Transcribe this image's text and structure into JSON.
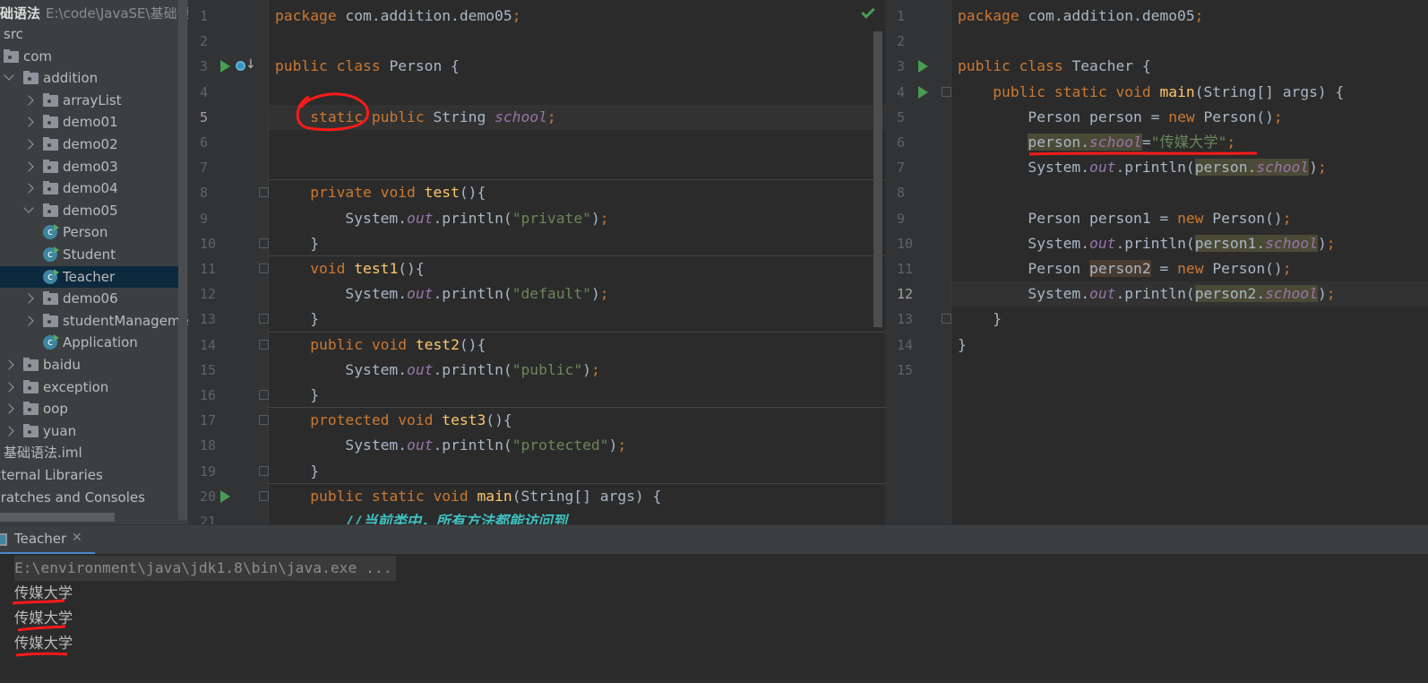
{
  "project": {
    "name": "础语法",
    "path": "E:\\code\\JavaSE\\基础语法"
  },
  "tree": [
    {
      "label": "src",
      "indent": 0,
      "icon": "none",
      "arrow": "none"
    },
    {
      "label": "com",
      "indent": 0,
      "icon": "package",
      "arrow": "none"
    },
    {
      "label": "addition",
      "indent": 0,
      "icon": "package",
      "arrow": "open"
    },
    {
      "label": "arrayList",
      "indent": 1,
      "icon": "package",
      "arrow": "closed"
    },
    {
      "label": "demo01",
      "indent": 1,
      "icon": "package",
      "arrow": "closed"
    },
    {
      "label": "demo02",
      "indent": 1,
      "icon": "package",
      "arrow": "closed"
    },
    {
      "label": "demo03",
      "indent": 1,
      "icon": "package",
      "arrow": "closed"
    },
    {
      "label": "demo04",
      "indent": 1,
      "icon": "package",
      "arrow": "closed"
    },
    {
      "label": "demo05",
      "indent": 1,
      "icon": "package",
      "arrow": "open"
    },
    {
      "label": "Person",
      "indent": 2,
      "icon": "class",
      "arrow": "none"
    },
    {
      "label": "Student",
      "indent": 2,
      "icon": "class",
      "arrow": "none"
    },
    {
      "label": "Teacher",
      "indent": 2,
      "icon": "class",
      "arrow": "none",
      "selected": true
    },
    {
      "label": "demo06",
      "indent": 1,
      "icon": "package",
      "arrow": "closed"
    },
    {
      "label": "studentManagement",
      "indent": 1,
      "icon": "package",
      "arrow": "closed"
    },
    {
      "label": "Application",
      "indent": 1,
      "icon": "class",
      "arrow": "none",
      "noArrowSpace": true
    },
    {
      "label": "baidu",
      "indent": 0,
      "icon": "package",
      "arrow": "closed"
    },
    {
      "label": "exception",
      "indent": 0,
      "icon": "package",
      "arrow": "closed"
    },
    {
      "label": "oop",
      "indent": 0,
      "icon": "package",
      "arrow": "closed"
    },
    {
      "label": "yuan",
      "indent": 0,
      "icon": "package",
      "arrow": "closed"
    },
    {
      "label": "基础语法.iml",
      "indent": 0,
      "icon": "none",
      "arrow": "none"
    },
    {
      "label": "External Libraries",
      "indent": -1,
      "icon": "none",
      "arrow": "none"
    },
    {
      "label": "Scratches and Consoles",
      "indent": -1,
      "icon": "none",
      "arrow": "none"
    }
  ],
  "left_editor": {
    "file": "Person",
    "current_line": 5,
    "status_icon": "check-icon",
    "lines": [
      [
        [
          "kw",
          "package "
        ],
        [
          "id",
          "com.addition.demo05"
        ],
        [
          "kw",
          ";"
        ]
      ],
      [],
      [
        [
          "kw",
          "public class "
        ],
        [
          "id",
          "Person {"
        ]
      ],
      [],
      [
        [
          "id",
          "    "
        ],
        [
          "kw",
          "static public "
        ],
        [
          "id",
          "String "
        ],
        [
          "field",
          "school"
        ],
        [
          "kw",
          ";"
        ]
      ],
      [],
      [],
      [
        [
          "id",
          "    "
        ],
        [
          "kw",
          "private void "
        ],
        [
          "fn",
          "test"
        ],
        [
          "id",
          "(){"
        ]
      ],
      [
        [
          "id",
          "        System."
        ],
        [
          "field",
          "out"
        ],
        [
          "id",
          ".println("
        ],
        [
          "str",
          "\"private\""
        ],
        [
          "id",
          ")"
        ],
        [
          "kw",
          ";"
        ]
      ],
      [
        [
          "id",
          "    }"
        ]
      ],
      [
        [
          "id",
          "    "
        ],
        [
          "kw",
          "void "
        ],
        [
          "fn",
          "test1"
        ],
        [
          "id",
          "(){"
        ]
      ],
      [
        [
          "id",
          "        System."
        ],
        [
          "field",
          "out"
        ],
        [
          "id",
          ".println("
        ],
        [
          "str",
          "\"default\""
        ],
        [
          "id",
          ")"
        ],
        [
          "kw",
          ";"
        ]
      ],
      [
        [
          "id",
          "    }"
        ]
      ],
      [
        [
          "id",
          "    "
        ],
        [
          "kw",
          "public void "
        ],
        [
          "fn",
          "test2"
        ],
        [
          "id",
          "(){"
        ]
      ],
      [
        [
          "id",
          "        System."
        ],
        [
          "field",
          "out"
        ],
        [
          "id",
          ".println("
        ],
        [
          "str",
          "\"public\""
        ],
        [
          "id",
          ")"
        ],
        [
          "kw",
          ";"
        ]
      ],
      [
        [
          "id",
          "    }"
        ]
      ],
      [
        [
          "id",
          "    "
        ],
        [
          "kw",
          "protected void "
        ],
        [
          "fn",
          "test3"
        ],
        [
          "id",
          "(){"
        ]
      ],
      [
        [
          "id",
          "        System."
        ],
        [
          "field",
          "out"
        ],
        [
          "id",
          ".println("
        ],
        [
          "str",
          "\"protected\""
        ],
        [
          "id",
          ")"
        ],
        [
          "kw",
          ";"
        ]
      ],
      [
        [
          "id",
          "    }"
        ]
      ],
      [
        [
          "id",
          "    "
        ],
        [
          "kw",
          "public static void "
        ],
        [
          "fn",
          "main"
        ],
        [
          "id",
          "(String[] args) {"
        ]
      ],
      [
        [
          "id",
          "        "
        ],
        [
          "cm",
          "//当前类中，所有方法都能访问到"
        ]
      ]
    ]
  },
  "right_editor": {
    "file": "Teacher",
    "current_line": 12,
    "lines": [
      [
        [
          "kw",
          "package "
        ],
        [
          "id",
          "com.addition.demo05"
        ],
        [
          "kw",
          ";"
        ]
      ],
      [],
      [
        [
          "kw",
          "public class "
        ],
        [
          "id",
          "Teacher {"
        ]
      ],
      [
        [
          "id",
          "    "
        ],
        [
          "kw",
          "public static void "
        ],
        [
          "fn",
          "main"
        ],
        [
          "id",
          "(String[] args) {"
        ]
      ],
      [
        [
          "id",
          "        Person person = "
        ],
        [
          "kw",
          "new "
        ],
        [
          "id",
          "Person()"
        ],
        [
          "kw",
          ";"
        ]
      ],
      [
        [
          "id",
          "        "
        ],
        [
          "id",
          "person.",
          "hl"
        ],
        [
          "field",
          "school",
          "hl"
        ],
        [
          "id",
          "="
        ],
        [
          "str",
          "\"传媒大学\""
        ],
        [
          "kw",
          ";"
        ]
      ],
      [
        [
          "id",
          "        System."
        ],
        [
          "field",
          "out"
        ],
        [
          "id",
          ".println("
        ],
        [
          "id",
          "person.",
          "hl"
        ],
        [
          "field",
          "school",
          "hl"
        ],
        [
          "id",
          ")"
        ],
        [
          "kw",
          ";"
        ]
      ],
      [],
      [
        [
          "id",
          "        Person person1 = "
        ],
        [
          "kw",
          "new "
        ],
        [
          "id",
          "Person()"
        ],
        [
          "kw",
          ";"
        ]
      ],
      [
        [
          "id",
          "        System."
        ],
        [
          "field",
          "out"
        ],
        [
          "id",
          ".println("
        ],
        [
          "id",
          "person1.",
          "hl"
        ],
        [
          "field",
          "school",
          "hl"
        ],
        [
          "id",
          ")"
        ],
        [
          "kw",
          ";"
        ]
      ],
      [
        [
          "id",
          "        Person "
        ],
        [
          "id",
          "person2",
          "hl2"
        ],
        [
          "id",
          " = "
        ],
        [
          "kw",
          "new "
        ],
        [
          "id",
          "Person()"
        ],
        [
          "kw",
          ";"
        ]
      ],
      [
        [
          "id",
          "        System."
        ],
        [
          "field",
          "out"
        ],
        [
          "id",
          ".println("
        ],
        [
          "id",
          "person2.",
          "hl"
        ],
        [
          "field",
          "school",
          "hl"
        ],
        [
          "id",
          ")"
        ],
        [
          "kw",
          ";"
        ]
      ],
      [
        [
          "id",
          "    }"
        ]
      ],
      [
        [
          "id",
          "}"
        ]
      ],
      []
    ]
  },
  "console": {
    "tab_label": "Teacher",
    "command": "E:\\environment\\java\\jdk1.8\\bin\\java.exe ...",
    "output": [
      "传媒大学",
      "传媒大学",
      "传媒大学"
    ]
  },
  "colors": {
    "annotation": "#ff1a1a",
    "accent": "#4a88c7",
    "run": "#499c54"
  }
}
